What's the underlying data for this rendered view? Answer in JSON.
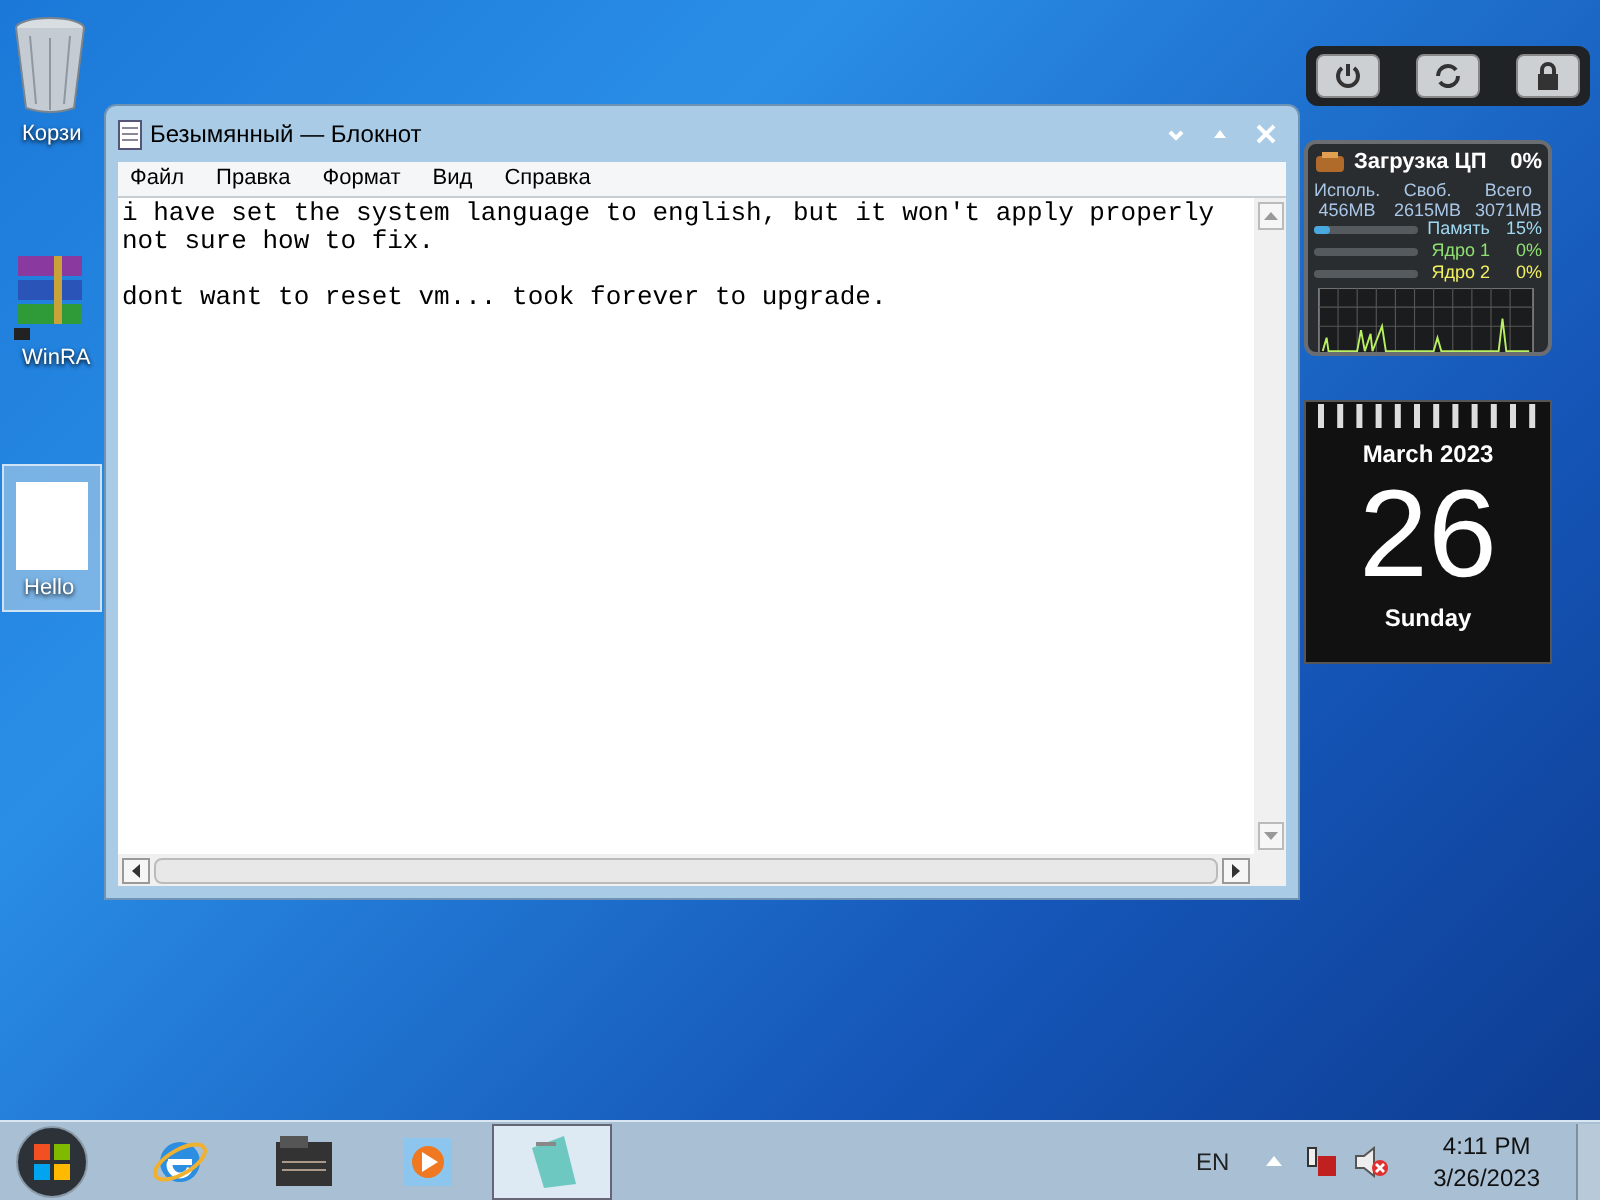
{
  "desktop_icons": [
    {
      "label": "Корзи",
      "kind": "trash",
      "selected": false
    },
    {
      "label": "WinRA",
      "kind": "archive",
      "selected": false
    },
    {
      "label": "Hello",
      "kind": "image",
      "selected": true
    }
  ],
  "notepad": {
    "title": "Безымянный — Блокнот",
    "menu": [
      "Файл",
      "Правка",
      "Формат",
      "Вид",
      "Справка"
    ],
    "paragraphs": [
      [
        "i have set the system language to english, but it won't apply properly",
        "not sure how to fix."
      ],
      [
        "dont want to reset vm... took forever to upgrade."
      ]
    ]
  },
  "cpu_gadget": {
    "title": "Загрузка ЦП",
    "cpu": "0%",
    "columns": [
      {
        "label": "Исполь.",
        "value": "456MB"
      },
      {
        "label": "Своб.",
        "value": "2615MB"
      },
      {
        "label": "Всего",
        "value": "3071MB"
      }
    ],
    "meters": [
      {
        "label": "Память",
        "reading": "15%",
        "level": 0.15,
        "color": "#9fd8f0"
      },
      {
        "label": "Ядро 1",
        "reading": "0%",
        "level": 0,
        "color": "#8fe070"
      },
      {
        "label": "Ядро 2",
        "reading": "0%",
        "level": 0,
        "color": "#f0f060"
      }
    ]
  },
  "calendar": {
    "month": "March 2023",
    "day": "26",
    "weekday": "Sunday"
  },
  "taskbar": {
    "apps": [
      {
        "kind": "ie",
        "active": false
      },
      {
        "kind": "folder",
        "active": false
      },
      {
        "kind": "media",
        "active": false
      },
      {
        "kind": "notepad",
        "active": true
      }
    ],
    "language": "EN",
    "time": "4:11 PM",
    "date": "3/26/2023"
  }
}
